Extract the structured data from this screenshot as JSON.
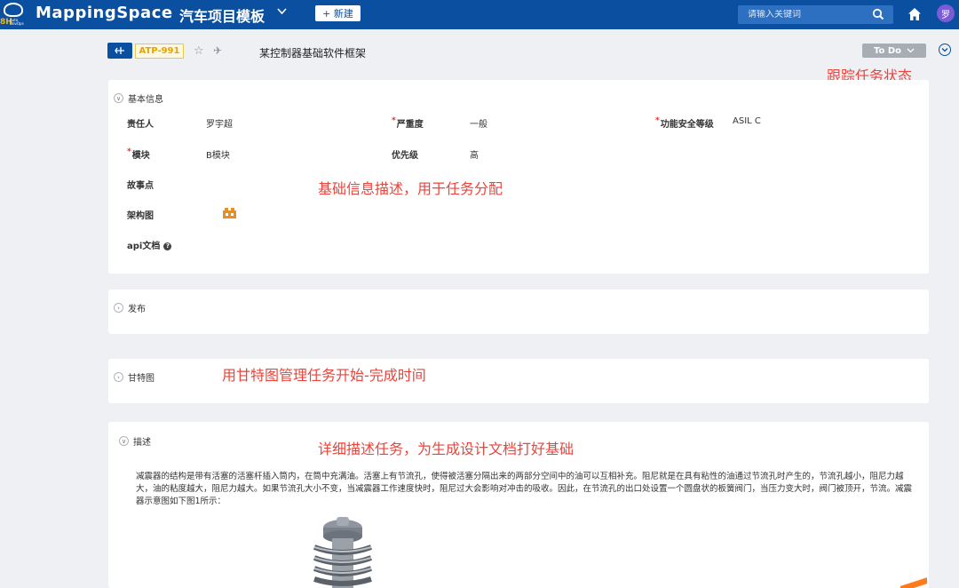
{
  "topbar": {
    "logo_badge": "8H",
    "logo_badge_sub": "Auto DevOps",
    "brand_name": "MappingSpace",
    "project_name": "汽车项目模板",
    "new_button": "+ 新建",
    "search_placeholder": "请输入关键词",
    "avatar_initial": "罗"
  },
  "issue": {
    "key": "ATP-991",
    "title": "某控制器基础软件框架",
    "status": "To Do"
  },
  "annotations": {
    "status": "跟踪任务状态",
    "basic": "基础信息描述，用于任务分配",
    "gantt": "用甘特图管理任务开始-完成时间",
    "desc": "详细描述任务，为生成设计文档打好基础"
  },
  "basic_info": {
    "title": "基本信息",
    "fields": {
      "owner_label": "责任人",
      "owner_value": "罗宇超",
      "severity_label": "严重度",
      "severity_value": "一般",
      "safety_label": "功能安全等级",
      "safety_value": "ASIL C",
      "module_label": "模块",
      "module_value": "B模块",
      "priority_label": "优先级",
      "priority_value": "高",
      "story_label": "故事点",
      "arch_label": "架构图",
      "api_label": "api文档"
    },
    "required_mark": "*",
    "help_mark": "?"
  },
  "release": {
    "title": "发布"
  },
  "gantt": {
    "title": "甘特图"
  },
  "description": {
    "title": "描述",
    "text": "减震器的结构是带有活塞的活塞杆插入筒内，在筒中充满油。活塞上有节流孔，使得被活塞分隔出来的两部分空间中的油可以互相补充。阻尼就是在具有粘性的油通过节流孔时产生的，节流孔越小，阻尼力越大，油的粘度越大，阻尼力越大。如果节流孔大小不变，当减震器工作速度快时，阻尼过大会影响对冲击的吸收。因此，在节流孔的出口处设置一个圆盘状的板簧阀门，当压力变大时，阀门被顶开，节流。减震器示意图如下图1所示："
  },
  "colors": {
    "topbar": "#0a4fa0",
    "annotation": "#e8453c",
    "key_badge": "#e6a400",
    "status_button": "#a8acb3"
  },
  "icons": [
    "logo-icon",
    "chevron-down-icon",
    "search-icon",
    "home-icon",
    "issue-type-icon",
    "star-icon",
    "pin-icon",
    "more-icon",
    "toggle-icon",
    "help-icon",
    "architecture-icon"
  ]
}
